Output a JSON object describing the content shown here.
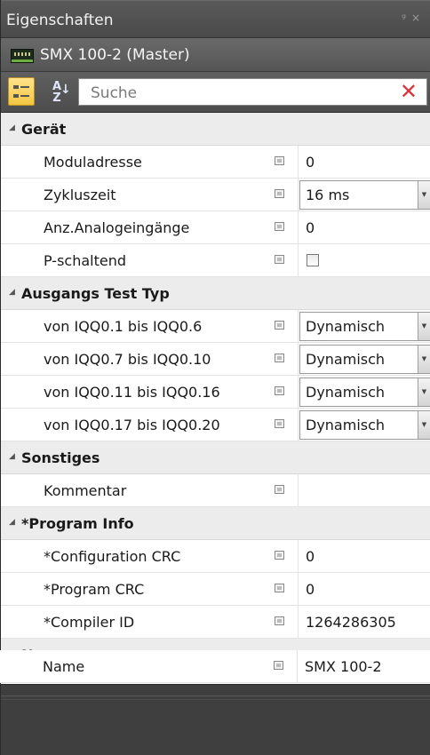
{
  "panel_title": "Eigenschaften",
  "title_icons": "⊑ ×",
  "object_title": "SMX 100-2 (Master)",
  "toolbar": {
    "sort_alpha_label": "A↓Z",
    "search_placeholder": "Suche",
    "clear_label": "✕"
  },
  "categories": {
    "geraet": "Gerät",
    "ausgangs": "Ausgangs Test Typ",
    "sonstiges": "Sonstiges",
    "program": "*Program Info",
    "name": "Name"
  },
  "properties": {
    "moduladresse": {
      "label": "Moduladresse",
      "value": "0"
    },
    "zykluszeit": {
      "label": "Zykluszeit",
      "value": "16 ms"
    },
    "analog": {
      "label": "Anz.Analogeingänge",
      "value": "0"
    },
    "pschaltend": {
      "label": "P-schaltend",
      "checked": false
    },
    "iqq1": {
      "label": "von IQQ0.1 bis IQQ0.6",
      "value": "Dynamisch"
    },
    "iqq2": {
      "label": "von IQQ0.7 bis IQQ0.10",
      "value": "Dynamisch"
    },
    "iqq3": {
      "label": "von IQQ0.11 bis IQQ0.16",
      "value": "Dynamisch"
    },
    "iqq4": {
      "label": "von IQQ0.17 bis IQQ0.20",
      "value": "Dynamisch"
    },
    "kommentar": {
      "label": "Kommentar",
      "value": ""
    },
    "configcrc": {
      "label": "*Configuration CRC",
      "value": "0"
    },
    "programcrc": {
      "label": "*Program CRC",
      "value": "0"
    },
    "compilerid": {
      "label": "*Compiler ID",
      "value": "1264286305"
    },
    "name": {
      "label": "Name",
      "value": "SMX 100-2"
    }
  },
  "colors": {
    "panel_bg": "#3f3f3f",
    "category_bg": "#ececec",
    "clear_icon": "#d9343a",
    "sort_button": "#f4c542"
  }
}
